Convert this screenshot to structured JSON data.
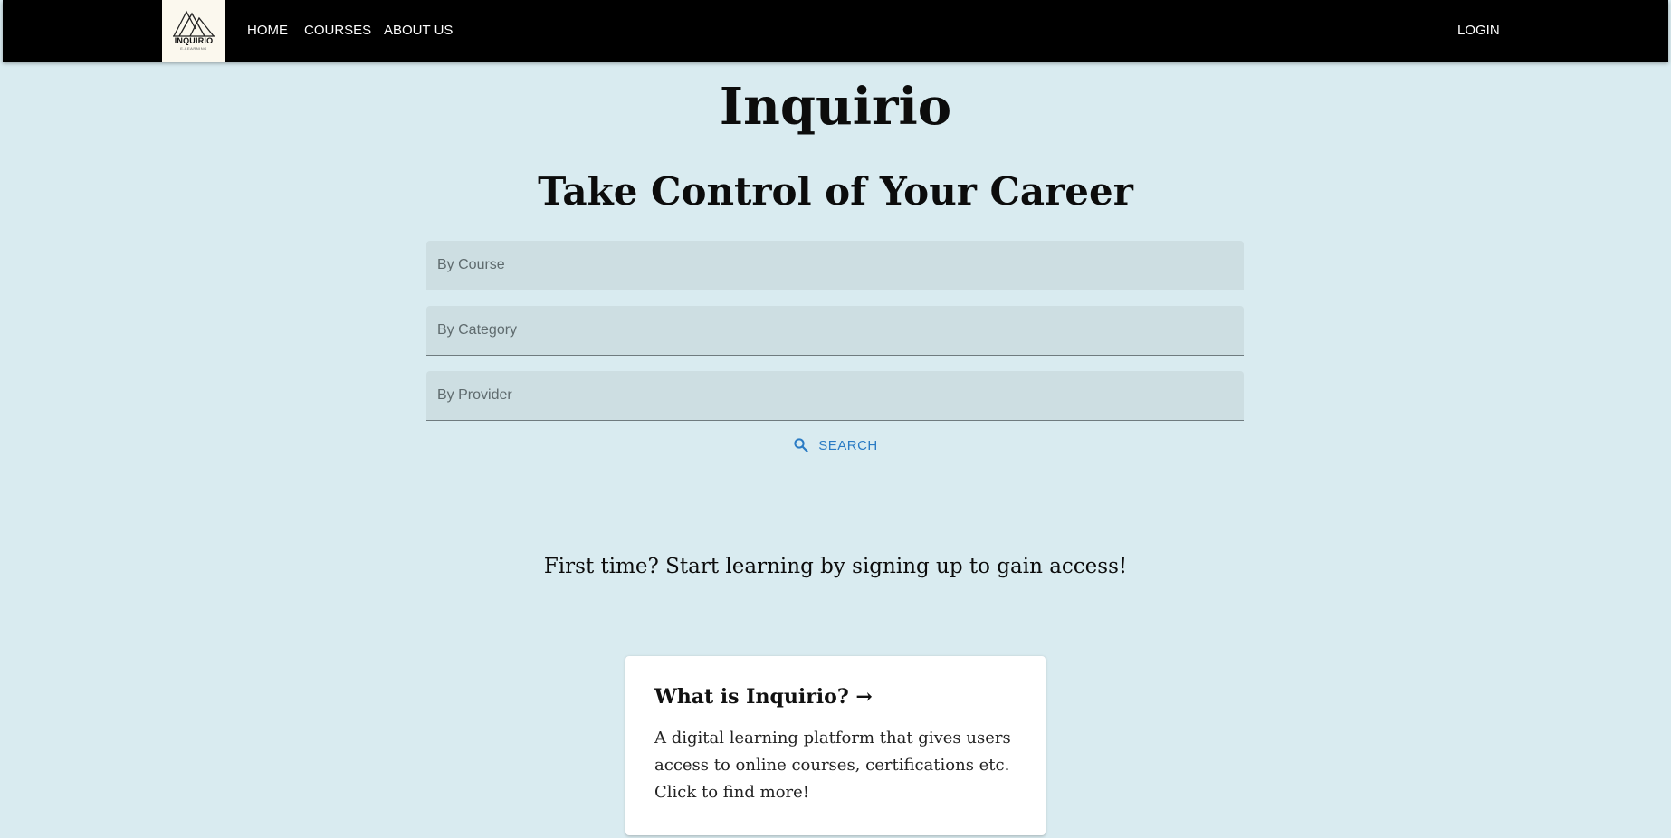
{
  "nav": {
    "logo_text": "INQUIRIO",
    "logo_subtext": "E-LEARNING",
    "home": "HOME",
    "courses": "COURSES",
    "about": "ABOUT US",
    "login": "LOGIN"
  },
  "hero": {
    "title": "Inquirio",
    "subtitle": "Take Control of Your Career"
  },
  "search": {
    "course_placeholder": "By Course",
    "category_placeholder": "By Category",
    "provider_placeholder": "By Provider",
    "button_label": "SEARCH",
    "button_icon": "search-icon"
  },
  "signup_prompt": "First time? Start learning by signing up to gain access!",
  "card": {
    "title": "What is Inquirio? →",
    "body": "A digital learning platform that gives users access to online courses, certifications etc. Click to find more!"
  },
  "colors": {
    "background": "#d9ebf0",
    "navbar": "#000000",
    "field_bg": "#cddee2",
    "accent": "#2a7bc4",
    "logo_bg": "#fbf8ee"
  }
}
